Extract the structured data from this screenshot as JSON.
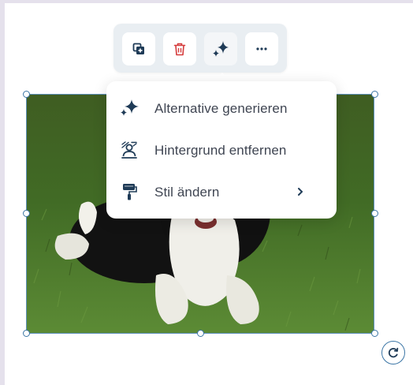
{
  "colors": {
    "accent": "#1f3b57",
    "danger": "#d53b3b",
    "selection": "#3c76a6",
    "menu_text": "#3f4552"
  },
  "toolbar": {
    "buttons": [
      {
        "icon": "duplicate-icon"
      },
      {
        "icon": "trash-icon"
      },
      {
        "icon": "sparkle-icon"
      },
      {
        "icon": "more-icon"
      }
    ]
  },
  "menu": {
    "items": [
      {
        "label": "Alternative generieren",
        "icon": "sparkle-icon"
      },
      {
        "label": "Hintergrund entfernen",
        "icon": "remove-background-icon"
      },
      {
        "label": "Stil ändern",
        "icon": "paint-roller-icon",
        "has_submenu": true
      }
    ]
  },
  "image": {
    "subject": "photo"
  },
  "rotate": {
    "icon": "rotate-icon"
  }
}
